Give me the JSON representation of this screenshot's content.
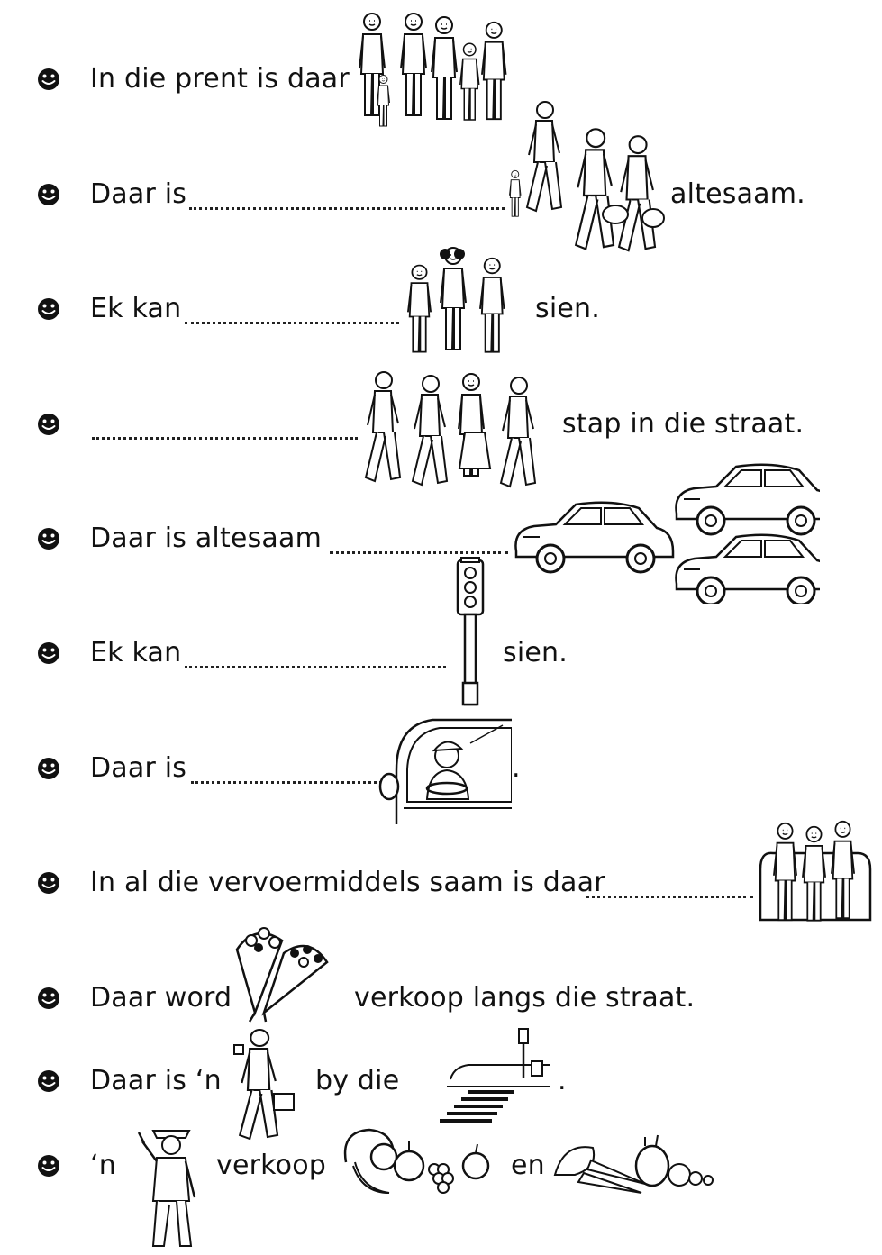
{
  "worksheet": {
    "lines": [
      {
        "bullet": "smiley-bullet",
        "text": "In die prent is daar",
        "picture": "family-of-seven-icon"
      },
      {
        "bullet": "smiley-bullet",
        "text_before": "Daar is",
        "text_after": "altesaam.",
        "picture": "family-walking-with-shopping-icon"
      },
      {
        "bullet": "smiley-bullet",
        "text_before": "Ek kan",
        "text_after": "sien.",
        "picture": "three-children-icon"
      },
      {
        "bullet": "smiley-bullet",
        "text_after": "stap in die straat.",
        "picture": "four-people-walking-icon"
      },
      {
        "bullet": "smiley-bullet",
        "text_before": "Daar is altesaam",
        "picture": "three-cars-icon"
      },
      {
        "bullet": "smiley-bullet",
        "text_before": "Ek kan",
        "text_after": "sien.",
        "picture": "traffic-light-icon"
      },
      {
        "bullet": "smiley-bullet",
        "text_before": "Daar is",
        "text_after": ".",
        "picture": "driver-in-car-icon"
      },
      {
        "bullet": "smiley-bullet",
        "text_before": "In al die vervoermiddels saam is daar",
        "picture": "passengers-on-bench-icon"
      },
      {
        "bullet": "smiley-bullet",
        "text_before": "Daar word",
        "text_after": "verkoop langs die straat.",
        "picture": "flower-bouquets-icon"
      },
      {
        "bullet": "smiley-bullet",
        "text_before": "Daar is ‘n",
        "text_middle": "by die",
        "text_after": ".",
        "picture": "pedestrian-icon",
        "picture2": "pedestrian-crossing-icon"
      },
      {
        "bullet": "smiley-bullet",
        "text_before": "‘n",
        "text_middle": "verkoop",
        "text_after": "en",
        "picture": "vendor-man-icon",
        "picture2": "fruit-icon",
        "picture3": "vegetables-icon"
      }
    ]
  }
}
